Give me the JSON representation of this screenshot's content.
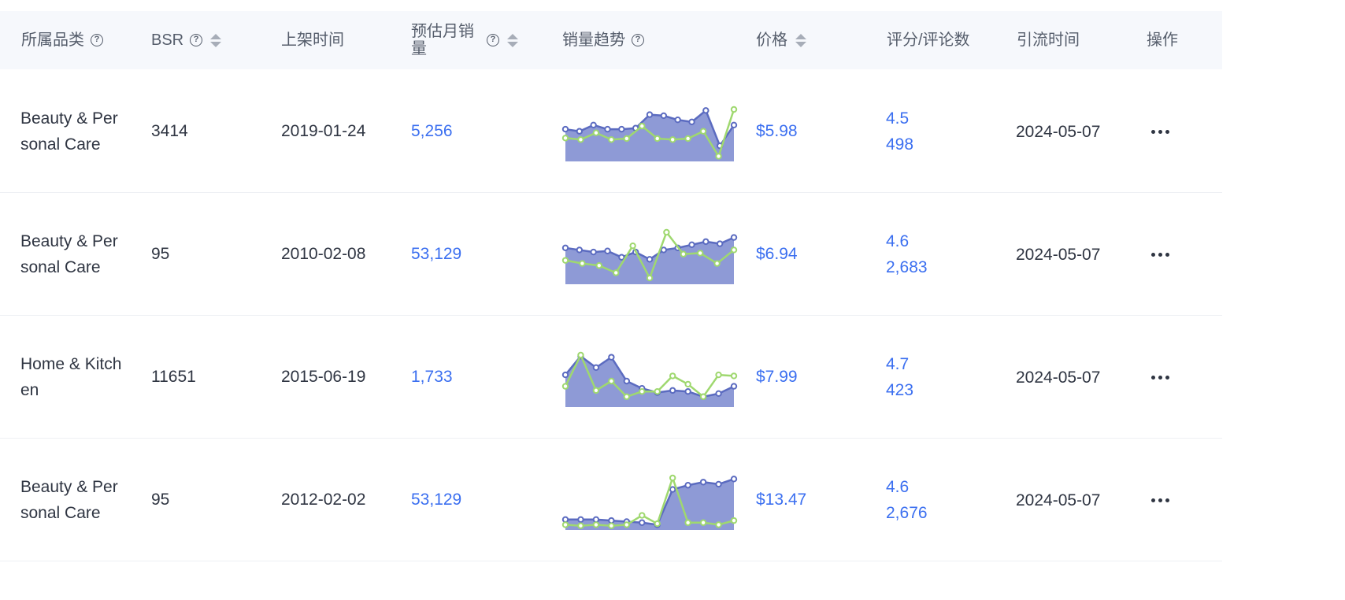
{
  "columns": [
    {
      "key": "category",
      "label": "所属品类",
      "help": true,
      "sortable": false
    },
    {
      "key": "bsr",
      "label": "BSR",
      "help": true,
      "sortable": true
    },
    {
      "key": "listed",
      "label": "上架时间",
      "help": false,
      "sortable": false
    },
    {
      "key": "monthly_sales",
      "label": "预估月销量",
      "help": true,
      "sortable": true
    },
    {
      "key": "trend",
      "label": "销量趋势",
      "help": true,
      "sortable": false
    },
    {
      "key": "price",
      "label": "价格",
      "help": false,
      "sortable": true
    },
    {
      "key": "rating",
      "label": "评分/评论数",
      "help": false,
      "sortable": false
    },
    {
      "key": "traffic_time",
      "label": "引流时间",
      "help": false,
      "sortable": false
    },
    {
      "key": "actions",
      "label": "操作",
      "help": false,
      "sortable": false
    }
  ],
  "colors": {
    "header_bg": "#f6f8fc",
    "link": "#3b6ff0",
    "trend_area": "#8e9ad6",
    "trend_line": "#5b6bc0",
    "trend_green": "#9fd86f"
  },
  "rows": [
    {
      "category": "Beauty & Personal Care",
      "bsr": "3414",
      "listed": "2019-01-24",
      "monthly_sales": "5,256",
      "price": "$5.98",
      "rating": "4.5",
      "reviews": "498",
      "traffic_time": "2024-05-07",
      "trend": {
        "blue": [
          0.62,
          0.58,
          0.7,
          0.62,
          0.62,
          0.64,
          0.9,
          0.88,
          0.8,
          0.76,
          0.98,
          0.3,
          0.7
        ],
        "green": [
          0.45,
          0.42,
          0.55,
          0.42,
          0.44,
          0.68,
          0.44,
          0.42,
          0.44,
          0.58,
          0.1,
          1.0
        ]
      }
    },
    {
      "category": "Beauty & Personal Care",
      "bsr": "95",
      "listed": "2010-02-08",
      "monthly_sales": "53,129",
      "price": "$6.94",
      "rating": "4.6",
      "reviews": "2,683",
      "traffic_time": "2024-05-07",
      "trend": {
        "blue": [
          0.7,
          0.66,
          0.62,
          0.64,
          0.52,
          0.62,
          0.48,
          0.66,
          0.7,
          0.76,
          0.82,
          0.78,
          0.9
        ],
        "green": [
          0.46,
          0.4,
          0.36,
          0.22,
          0.74,
          0.12,
          1.0,
          0.58,
          0.6,
          0.4,
          0.66
        ]
      }
    },
    {
      "category": "Home & Kitchen",
      "bsr": "11651",
      "listed": "2015-06-19",
      "monthly_sales": "1,733",
      "price": "$7.99",
      "rating": "4.7",
      "reviews": "423",
      "traffic_time": "2024-05-07",
      "trend": {
        "blue": [
          0.62,
          0.98,
          0.76,
          0.96,
          0.5,
          0.36,
          0.28,
          0.32,
          0.3,
          0.2,
          0.26,
          0.4
        ],
        "green": [
          0.4,
          1.0,
          0.32,
          0.5,
          0.2,
          0.3,
          0.3,
          0.6,
          0.44,
          0.2,
          0.62,
          0.6
        ]
      }
    },
    {
      "category": "Beauty & Personal Care",
      "bsr": "95",
      "listed": "2012-02-02",
      "monthly_sales": "53,129",
      "price": "$13.47",
      "rating": "4.6",
      "reviews": "2,676",
      "traffic_time": "2024-05-07",
      "trend": {
        "blue": [
          0.2,
          0.2,
          0.2,
          0.18,
          0.16,
          0.14,
          0.1,
          0.78,
          0.86,
          0.92,
          0.88,
          0.98
        ],
        "green": [
          0.1,
          0.08,
          0.1,
          0.08,
          0.1,
          0.28,
          0.12,
          1.0,
          0.14,
          0.14,
          0.1,
          0.18
        ]
      }
    }
  ]
}
